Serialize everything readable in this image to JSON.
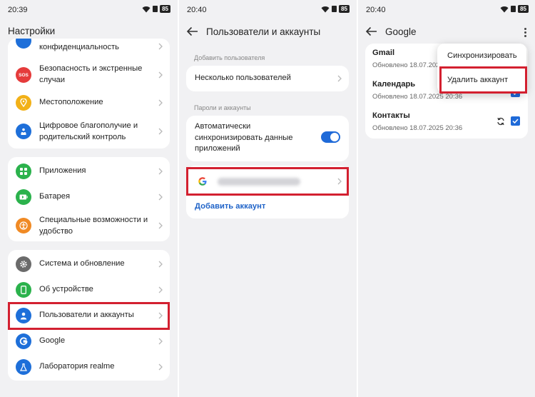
{
  "screens": [
    {
      "status_time": "20:39",
      "battery": "85",
      "title": "Настройки",
      "groups": [
        {
          "items": [
            {
              "label": "конфиденциальность",
              "icon": "privacy-icon",
              "color": "#1e6fd9"
            },
            {
              "label": "Безопасность и экстренные случаи",
              "icon": "sos-icon",
              "color": "#e53b3b",
              "icon_text": "SOS"
            },
            {
              "label": "Местоположение",
              "icon": "location-icon",
              "color": "#f2b118"
            },
            {
              "label": "Цифровое благополучие и родительский контроль",
              "icon": "wellbeing-icon",
              "color": "#1e6fd9"
            }
          ]
        },
        {
          "items": [
            {
              "label": "Приложения",
              "icon": "apps-icon",
              "color": "#2bb24c"
            },
            {
              "label": "Батарея",
              "icon": "battery-icon",
              "color": "#2bb24c"
            },
            {
              "label": "Специальные возможности и удобство",
              "icon": "accessibility-icon",
              "color": "#f08a24"
            }
          ]
        },
        {
          "items": [
            {
              "label": "Система и обновление",
              "icon": "gear-icon",
              "color": "#6b6b6b"
            },
            {
              "label": "Об устройстве",
              "icon": "phone-icon",
              "color": "#2bb24c"
            },
            {
              "label": "Пользователи и аккаунты",
              "icon": "user-icon",
              "color": "#1e6fd9"
            },
            {
              "label": "Google",
              "icon": "google-g-icon",
              "color": "#1e6fd9"
            },
            {
              "label": "Лаборатория realme",
              "icon": "flask-icon",
              "color": "#1e6fd9"
            }
          ]
        }
      ]
    },
    {
      "status_time": "20:40",
      "battery": "85",
      "title": "Пользователи и аккаунты",
      "section_add_user": "Добавить пользователя",
      "multi_users": "Несколько пользователей",
      "section_passwords": "Пароли и аккаунты",
      "auto_sync": "Автоматически синхронизировать данные приложений",
      "auto_sync_on": true,
      "add_account": "Добавить аккаунт"
    },
    {
      "status_time": "20:40",
      "battery": "85",
      "title": "Google",
      "sync_items": [
        {
          "name": "Gmail",
          "updated": "Обновлено 18.07.2025"
        },
        {
          "name": "Календарь",
          "updated": "Обновлено 18.07.2025 20:36"
        },
        {
          "name": "Контакты",
          "updated": "Обновлено 18.07.2025 20:36"
        }
      ],
      "menu": {
        "sync": "Синхронизировать",
        "delete": "Удалить аккаунт"
      }
    }
  ],
  "colors": {
    "accent": "#1f6ad8",
    "highlight": "#d32030",
    "link": "#1f63c8"
  }
}
